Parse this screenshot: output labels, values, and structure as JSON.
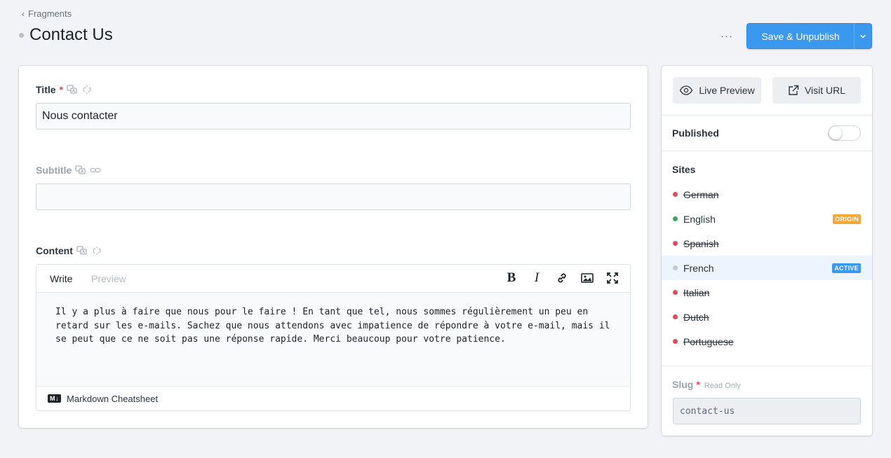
{
  "breadcrumb": {
    "label": "Fragments"
  },
  "header": {
    "title": "Contact Us",
    "more": "···",
    "save_label": "Save & Unpublish"
  },
  "fields": {
    "title": {
      "label": "Title",
      "required_mark": "*",
      "value": "Nous contacter"
    },
    "subtitle": {
      "label": "Subtitle",
      "value": ""
    },
    "content": {
      "label": "Content",
      "tabs": {
        "write": "Write",
        "preview": "Preview"
      },
      "tools": {
        "bold": "B",
        "italic": "I"
      },
      "text": "Il y a plus à faire que nous pour le faire ! En tant que tel, nous sommes régulièrement un peu en retard sur les e-mails. Sachez que nous attendons avec impatience de répondre à votre e-mail, mais il se peut que ce ne soit pas une réponse rapide. Merci beaucoup pour votre patience.",
      "footer_badge": "M↓",
      "footer_link": "Markdown Cheatsheet"
    }
  },
  "sidebar": {
    "live_preview": "Live Preview",
    "visit_url": "Visit URL",
    "published_label": "Published",
    "published": false,
    "sites_label": "Sites",
    "sites": [
      {
        "name": "German",
        "status": "red",
        "strike": true,
        "tag": ""
      },
      {
        "name": "English",
        "status": "green",
        "strike": false,
        "tag": "ORIGIN"
      },
      {
        "name": "Spanish",
        "status": "red",
        "strike": true,
        "tag": ""
      },
      {
        "name": "French",
        "status": "grey",
        "strike": false,
        "tag": "ACTIVE"
      },
      {
        "name": "Italian",
        "status": "red",
        "strike": true,
        "tag": ""
      },
      {
        "name": "Dutch",
        "status": "red",
        "strike": true,
        "tag": ""
      },
      {
        "name": "Portuguese",
        "status": "red",
        "strike": true,
        "tag": ""
      }
    ],
    "slug_label": "Slug",
    "slug_required": "*",
    "slug_readonly": "Read Only",
    "slug_value": "contact-us"
  },
  "colors": {
    "accent": "#3a99ef",
    "status_red": "#e3485b",
    "status_green": "#3ba55c",
    "status_grey": "#c3cad2",
    "origin_tag": "#f4a836",
    "active_tag": "#3a99ef"
  }
}
